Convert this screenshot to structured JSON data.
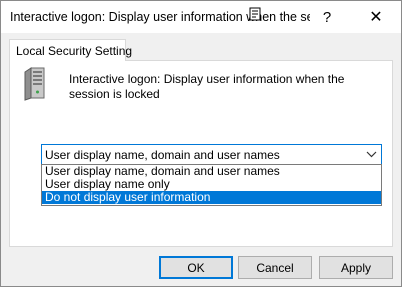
{
  "window": {
    "title": "Interactive logon: Display user information when the ses...",
    "help_glyph": "?",
    "close_glyph": "✕"
  },
  "tabs": [
    {
      "label": "Local Security Setting"
    }
  ],
  "policy": {
    "icon": "server-icon",
    "description": "Interactive logon: Display user information when the session is locked"
  },
  "combo": {
    "selected_value": "User display name, domain and user names",
    "options": [
      "User display name, domain and user names",
      "User display name only",
      "Do not display user information"
    ],
    "highlighted_index": 2
  },
  "buttons": {
    "ok": "OK",
    "cancel": "Cancel",
    "apply": "Apply"
  },
  "colors": {
    "accent": "#0078d7",
    "dialog_bg": "#f0f0f0",
    "button_bg": "#e1e1e1"
  }
}
